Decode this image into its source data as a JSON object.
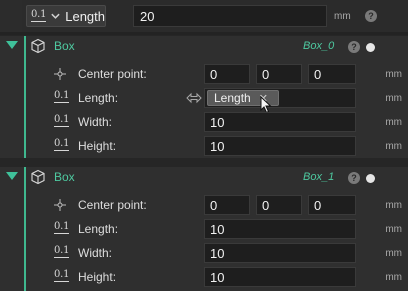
{
  "top": {
    "param_label": "Length",
    "value": "20",
    "unit": "mm",
    "help": "?"
  },
  "panels": [
    {
      "title": "Box",
      "id": "Box_0",
      "help": "?",
      "rows": [
        {
          "label": "Center point:",
          "values": [
            "0",
            "0",
            "0"
          ],
          "unit": "mm"
        },
        {
          "label": "Length:",
          "token": "Length",
          "unit": "mm"
        },
        {
          "label": "Width:",
          "value": "10",
          "unit": "mm"
        },
        {
          "label": "Height:",
          "value": "10",
          "unit": "mm"
        }
      ]
    },
    {
      "title": "Box",
      "id": "Box_1",
      "help": "?",
      "rows": [
        {
          "label": "Center point:",
          "values": [
            "0",
            "0",
            "0"
          ],
          "unit": "mm"
        },
        {
          "label": "Length:",
          "value": "10",
          "unit": "mm"
        },
        {
          "label": "Width:",
          "value": "10",
          "unit": "mm"
        },
        {
          "label": "Height:",
          "value": "10",
          "unit": "mm"
        }
      ]
    }
  ],
  "colors": {
    "accent": "#3fb88f",
    "title": "#4ec9a0",
    "background": "#262626"
  }
}
